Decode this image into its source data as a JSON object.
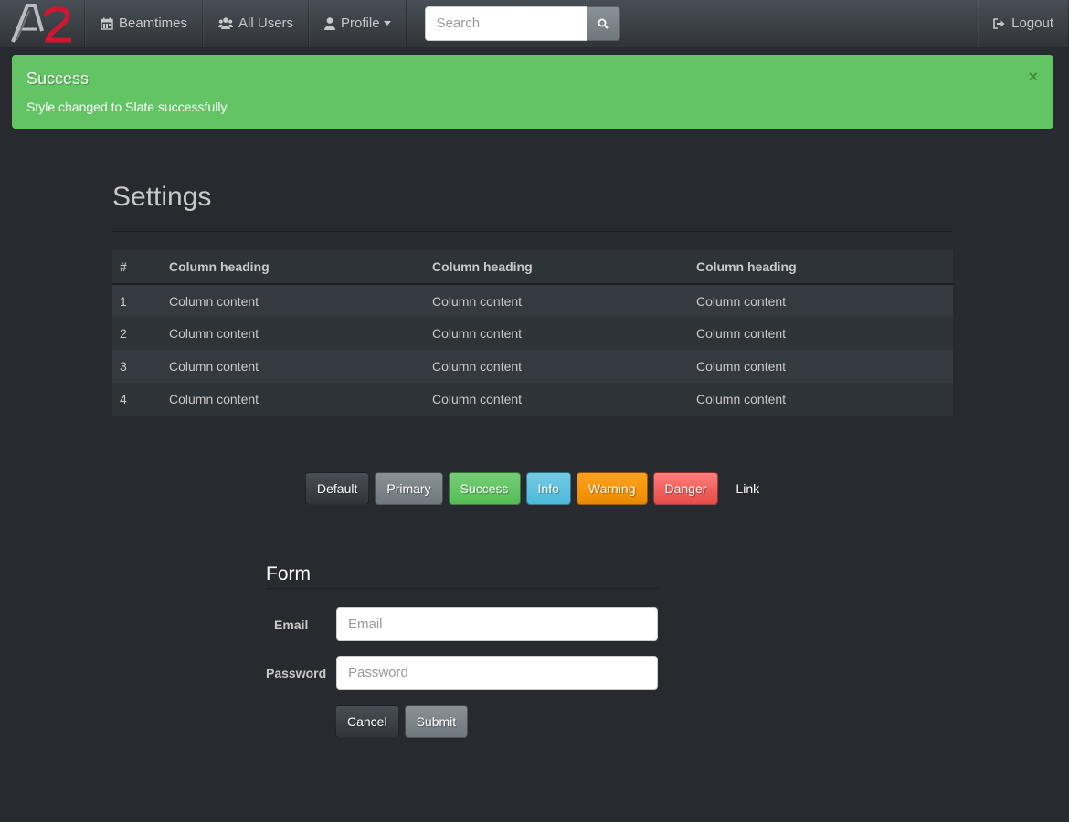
{
  "navbar": {
    "brand_text": "A2",
    "items": [
      {
        "label": "Beamtimes",
        "icon": "calendar-icon"
      },
      {
        "label": "All Users",
        "icon": "users-icon"
      },
      {
        "label": "Profile",
        "icon": "user-icon"
      }
    ],
    "search": {
      "placeholder": "Search",
      "value": ""
    },
    "logout_label": "Logout"
  },
  "alert": {
    "title": "Success",
    "message": "Style changed to Slate successfully.",
    "close": "×",
    "color": "#62c462"
  },
  "page": {
    "title": "Settings"
  },
  "table": {
    "headers": [
      "#",
      "Column heading",
      "Column heading",
      "Column heading"
    ],
    "rows": [
      [
        "1",
        "Column content",
        "Column content",
        "Column content"
      ],
      [
        "2",
        "Column content",
        "Column content",
        "Column content"
      ],
      [
        "3",
        "Column content",
        "Column content",
        "Column content"
      ],
      [
        "4",
        "Column content",
        "Column content",
        "Column content"
      ]
    ]
  },
  "buttons": {
    "default": "Default",
    "primary": "Primary",
    "success": "Success",
    "info": "Info",
    "warning": "Warning",
    "danger": "Danger",
    "link": "Link"
  },
  "form": {
    "title": "Form",
    "email_label": "Email",
    "email_placeholder": "Email",
    "email_value": "",
    "password_label": "Password",
    "password_placeholder": "Password",
    "password_value": "",
    "cancel_label": "Cancel",
    "submit_label": "Submit"
  },
  "colors": {
    "background": "#272b30",
    "success": "#62c462",
    "info": "#5bc0de",
    "warning": "#f89406",
    "danger": "#ee5f5b",
    "primary": "#7a8288",
    "brand_red": "#d0162f"
  }
}
